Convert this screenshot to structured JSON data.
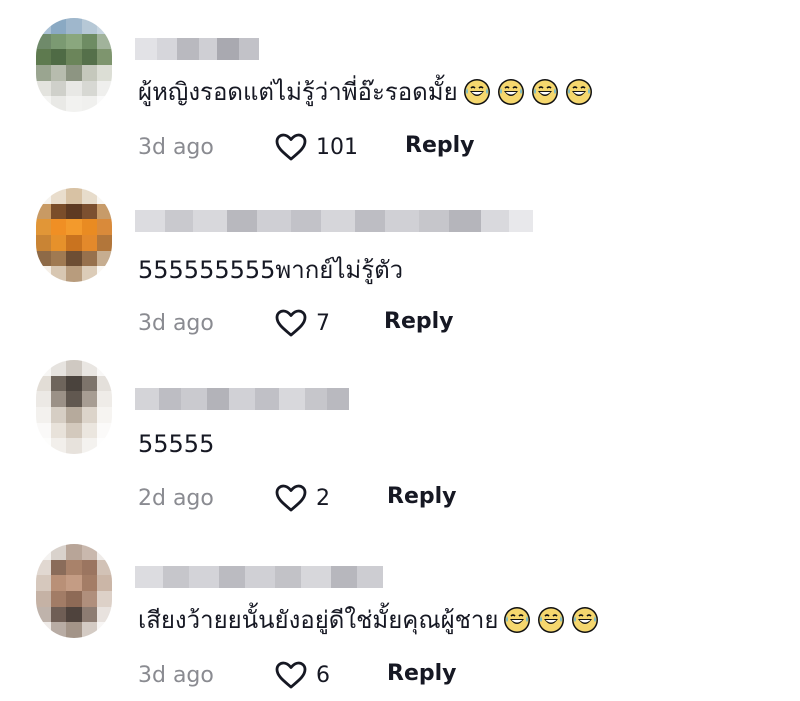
{
  "comments": [
    {
      "text": "ผู้หญิงรอดแต่ไม่รู้ว่าพี่อ๊ะรอดมั้ย",
      "emoji_count": 4,
      "emoji_icon": "grinning-sweat-emoji-icon",
      "time": "3d ago",
      "likes": "101",
      "reply_label": "Reply"
    },
    {
      "text": "555555555พากย์ไม่รู้ตัว",
      "emoji_count": 0,
      "time": "3d ago",
      "likes": "7",
      "reply_label": "Reply"
    },
    {
      "text": "55555",
      "emoji_count": 0,
      "time": "2d ago",
      "likes": "2",
      "reply_label": "Reply"
    },
    {
      "text": "เสียงว้ายยนั้นยังอยู่ดีใช่มั้ยคุณผู้ชาย",
      "emoji_count": 3,
      "emoji_icon": "grinning-sweat-emoji-icon",
      "time": "3d ago",
      "likes": "6",
      "reply_label": "Reply"
    }
  ],
  "colors": {
    "text": "#161823",
    "muted": "#8a8b91",
    "blurred_username": "#d0d0d4"
  },
  "icons": {
    "like": "heart-outline-icon",
    "avatar": "blurred-avatar",
    "username": "blurred-username"
  }
}
